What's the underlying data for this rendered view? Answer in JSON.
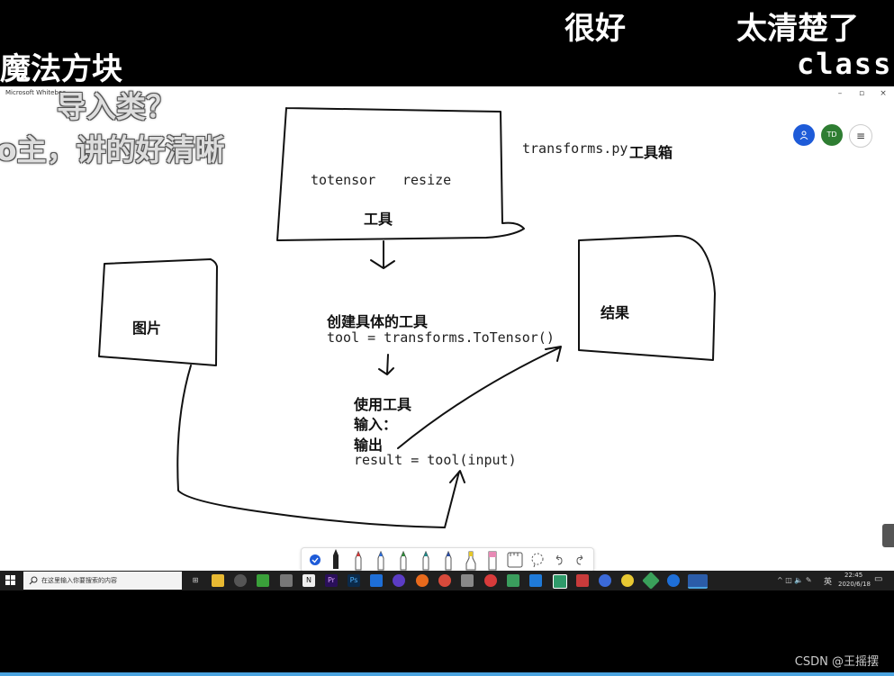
{
  "danmaku": {
    "top_left": "魔法方块",
    "top_mid": "很好",
    "top_right": "太清楚了",
    "top_class": "class",
    "overlay_1": "导入类？",
    "overlay_2": "o主，讲的好清晰"
  },
  "window": {
    "title": "Microsoft Whiteboa",
    "controls": [
      "–",
      "▫",
      "×"
    ]
  },
  "whiteboard": {
    "transforms_label": "transforms.py",
    "toolbox_label": "工具箱",
    "tool_examples": [
      "totensor",
      "resize"
    ],
    "tool_box_title": "工具",
    "image_box_title": "图片",
    "result_box_title": "结果",
    "create_title": "创建具体的工具",
    "create_code": "tool = transforms.ToTensor()",
    "use_title": "使用工具",
    "input_label": "输入：",
    "output_label": "输出",
    "use_code": "result = tool(input)"
  },
  "participants": [
    {
      "initials": "",
      "color": "#1e5bd8",
      "icon": "person-icon"
    },
    {
      "initials": "TD",
      "color": "#2e7d32",
      "icon": ""
    }
  ],
  "pen_toolbar": {
    "pens": [
      {
        "name": "select-icon",
        "color": "#1e5bd8"
      },
      {
        "name": "pen-black-icon",
        "color": "#222222"
      },
      {
        "name": "pen-red-icon",
        "color": "#d83b3b"
      },
      {
        "name": "pen-blue-icon",
        "color": "#2b6cd8"
      },
      {
        "name": "pen-green-icon",
        "color": "#2e8b3a"
      },
      {
        "name": "pen-teal-icon",
        "color": "#1f8a8a"
      },
      {
        "name": "pen-navy-icon",
        "color": "#2b4fa8"
      },
      {
        "name": "highlighter-yellow-icon",
        "color": "#e6c829"
      },
      {
        "name": "highlighter-pink-icon",
        "color": "#e88ab5"
      },
      {
        "name": "ruler-icon",
        "color": "#555555"
      },
      {
        "name": "lasso-icon",
        "color": "#555555"
      },
      {
        "name": "undo-icon",
        "color": "#555555"
      },
      {
        "name": "redo-icon",
        "color": "#555555"
      }
    ]
  },
  "taskbar": {
    "search_placeholder": "在这里输入你要搜索的内容",
    "time": "22:45",
    "date": "2020/6/18",
    "ime": "英"
  },
  "watermark": "CSDN @王摇摆"
}
